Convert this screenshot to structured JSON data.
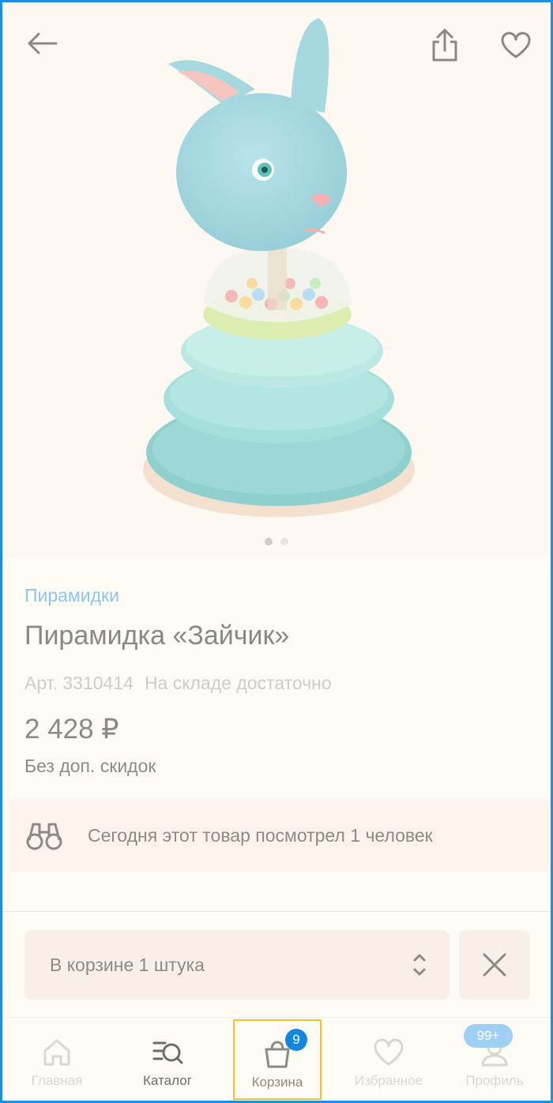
{
  "header": {
    "back_icon": "arrow-left-icon",
    "share_icon": "share-icon",
    "favorite_icon": "heart-outline-icon"
  },
  "gallery": {
    "image_alt": "Пирамидка «Зайчик»",
    "pages": 2,
    "active_page": 1
  },
  "product": {
    "category": "Пирамидки",
    "title": "Пирамидка «Зайчик»",
    "article": "Арт. 3310414",
    "stock": "На складе достаточно",
    "price": "2 428 ₽",
    "discount_note": "Без доп. скидок"
  },
  "viewers": {
    "icon": "binoculars-icon",
    "text": "Сегодня этот товар посмотрел 1 человек"
  },
  "cart_control": {
    "label": "В корзине 1 штука",
    "stepper_icon": "chevron-up-down-icon",
    "remove_icon": "close-icon"
  },
  "tabbar": {
    "items": [
      {
        "label": "Главная",
        "icon": "home-icon"
      },
      {
        "label": "Каталог",
        "icon": "catalog-search-icon"
      },
      {
        "label": "Корзина",
        "icon": "shopping-bag-icon",
        "badge": "9"
      },
      {
        "label": "Избранное",
        "icon": "heart-icon"
      },
      {
        "label": "Профиль",
        "icon": "profile-icon",
        "badge": "99+"
      }
    ]
  },
  "colors": {
    "accent_blue": "#1486df",
    "highlight_border": "#f2c232",
    "frame_border": "#1a8fe3"
  }
}
